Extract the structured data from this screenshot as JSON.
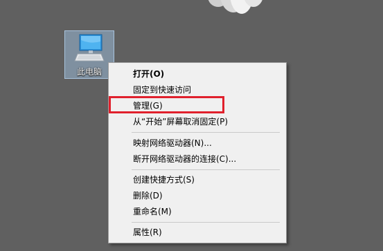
{
  "desktop": {
    "icon": {
      "name": "computer-icon",
      "label": "此电脑"
    }
  },
  "context_menu": {
    "items": [
      {
        "label": "打开(O)",
        "bold": true
      },
      {
        "label": "固定到快速访问"
      },
      {
        "label": "管理(G)",
        "highlighted": true
      },
      {
        "label": "从“开始”屏幕取消固定(P)"
      },
      {
        "label": "映射网络驱动器(N)..."
      },
      {
        "label": "断开网络驱动器的连接(C)..."
      },
      {
        "label": "创建快捷方式(S)"
      },
      {
        "label": "删除(D)"
      },
      {
        "label": "重命名(M)"
      },
      {
        "label": "属性(R)"
      }
    ]
  },
  "colors": {
    "desktop_bg": "#606060",
    "menu_bg": "#f0f0f0",
    "highlight_border": "#e0202c",
    "icon_selection": "#99b8d6"
  }
}
